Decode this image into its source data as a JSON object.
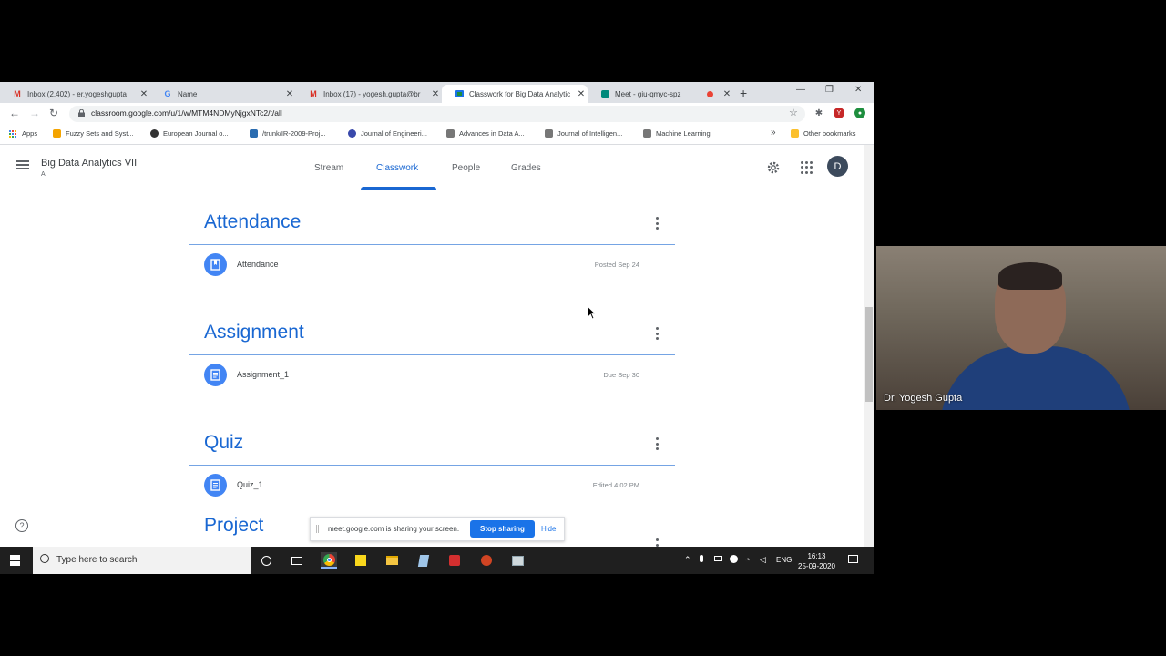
{
  "browser": {
    "tabs": [
      {
        "title": "Inbox (2,402) - er.yogeshgupta",
        "icon": "gmail-icon",
        "active": false
      },
      {
        "title": "Name",
        "icon": "google-icon",
        "active": false
      },
      {
        "title": "Inbox (17) - yogesh.gupta@br",
        "icon": "gmail-icon",
        "active": false
      },
      {
        "title": "Classwork for Big Data Analytic",
        "icon": "classroom-icon",
        "active": true
      },
      {
        "title": "Meet - giu-qmyc-spz",
        "icon": "meet-icon",
        "active": false
      }
    ],
    "url": "classroom.google.com/u/1/w/MTM4NDMyNjgxNTc2/t/all",
    "extension_avatar": "Y",
    "bookmarks": [
      {
        "label": "Apps",
        "color": "#4285f4"
      },
      {
        "label": "Fuzzy Sets and Syst...",
        "color": "#f4a400"
      },
      {
        "label": "European Journal o...",
        "color": "#333333"
      },
      {
        "label": "/trunk/IR-2009-Proj...",
        "color": "#2b6cb0"
      },
      {
        "label": "Journal of Engineeri...",
        "color": "#3949ab"
      },
      {
        "label": "Advances in Data A...",
        "color": "#555555"
      },
      {
        "label": "Journal of Intelligen...",
        "color": "#555555"
      },
      {
        "label": "Machine Learning",
        "color": "#555555"
      }
    ],
    "overflow": "»",
    "other_bookmarks": "Other bookmarks"
  },
  "classroom": {
    "class_name": "Big Data Analytics VII",
    "section": "A",
    "nav_tabs": [
      "Stream",
      "Classwork",
      "People",
      "Grades"
    ],
    "active_tab": "Classwork",
    "avatar_letter": "D",
    "topics": [
      {
        "title": "Attendance",
        "items": [
          {
            "title": "Attendance",
            "meta": "Posted Sep 24",
            "icon": "material-icon"
          }
        ]
      },
      {
        "title": "Assignment",
        "items": [
          {
            "title": "Assignment_1",
            "meta": "Due Sep 30",
            "icon": "assignment-icon"
          }
        ]
      },
      {
        "title": "Quiz",
        "items": [
          {
            "title": "Quiz_1",
            "meta": "Edited 4:02 PM",
            "icon": "assignment-icon"
          }
        ]
      }
    ],
    "partial_topic": "Project"
  },
  "share_bar": {
    "message": "meet.google.com is sharing your screen.",
    "stop_label": "Stop sharing",
    "hide_label": "Hide"
  },
  "taskbar": {
    "search_placeholder": "Type here to search",
    "language": "ENG",
    "time": "16:13",
    "date": "25-09-2020"
  },
  "video": {
    "presenter_name": "Dr. Yogesh Gupta"
  }
}
